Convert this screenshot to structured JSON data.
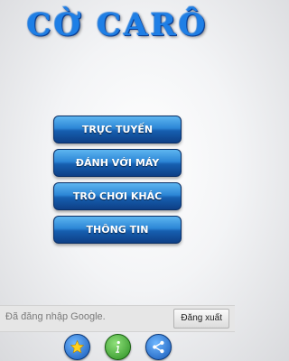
{
  "app": {
    "title": "CỜ CARÔ"
  },
  "menu": {
    "items": [
      {
        "label": "TRỰC TUYẾN"
      },
      {
        "label": "ĐÁNH VỚI MÁY"
      },
      {
        "label": "TRÒ CHƠI KHÁC"
      },
      {
        "label": "THÔNG TIN"
      }
    ]
  },
  "status": {
    "text": "Đã đăng nhập Google.",
    "logout_label": "Đăng xuất"
  },
  "bottom_icons": [
    {
      "icon": "star-icon"
    },
    {
      "icon": "info-icon"
    },
    {
      "icon": "share-icon"
    }
  ],
  "colors": {
    "accent": "#1e7fe6",
    "button_dark": "#0e3f86",
    "info_green": "#2a8f22"
  }
}
